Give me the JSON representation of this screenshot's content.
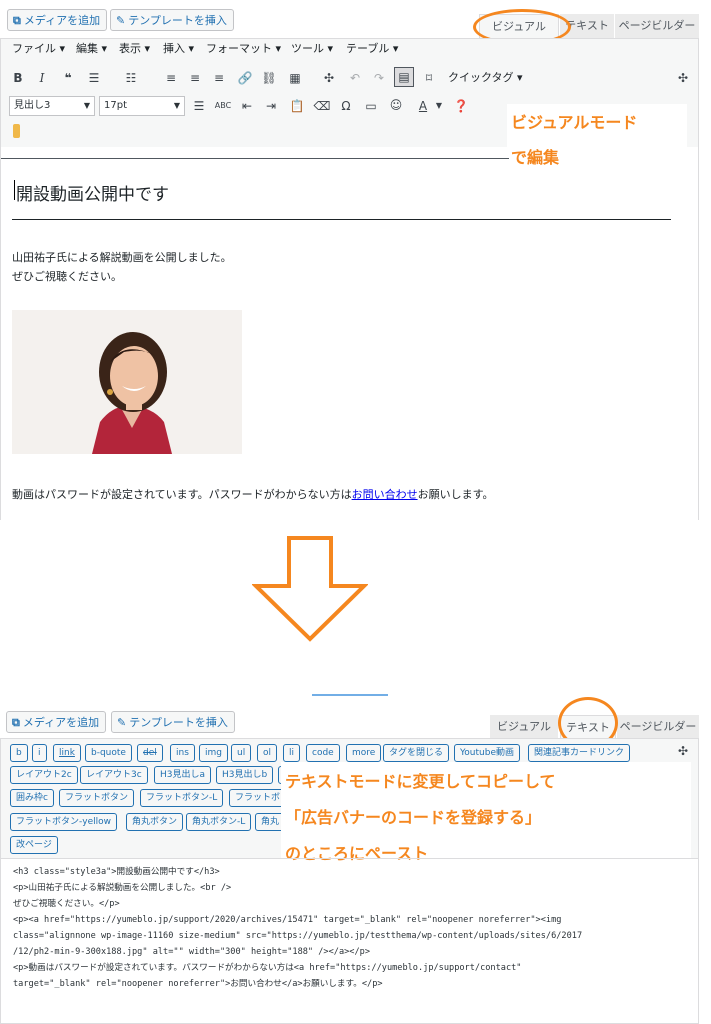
{
  "top": {
    "media_btn": "メディアを追加",
    "template_btn": "テンプレートを挿入",
    "tabs": [
      "ビジュアル",
      "テキスト",
      "ページビルダー"
    ],
    "menus": [
      "ファイル ▾",
      "編集 ▾",
      "表示 ▾",
      "挿入 ▾",
      "フォーマット ▾",
      "ツール ▾",
      "テーブル ▾"
    ],
    "quicktag": "クイックタグ ▾",
    "heading_select": "見出し3",
    "size_select": "17pt",
    "annotation": [
      "ビジュアルモード",
      "で編集"
    ],
    "content": {
      "heading": "開設動画公開中です",
      "p1": "山田祐子氏による解説動画を公開しました。",
      "p2": "ぜひご視聴ください。",
      "p3_before": "動画はパスワードが設定されています。パスワードがわからない方は",
      "p3_link": "お問い合わせ",
      "p3_after": "お願いします。"
    }
  },
  "bottom": {
    "media_btn": "メディアを追加",
    "template_btn": "テンプレートを挿入",
    "tabs": [
      "ビジュアル",
      "テキスト",
      "ページビルダー"
    ],
    "quicktags_row1": [
      "b",
      "i",
      "link",
      "b-quote",
      "del",
      "ins",
      "img",
      "ul",
      "ol",
      "li",
      "code",
      "more",
      "タグを閉じる",
      "Youtube動画",
      "関連記事カードリンク"
    ],
    "quicktags_row2": [
      "レイアウト2c",
      "レイアウト3c",
      "H3見出しa",
      "H3見出しb",
      "H3"
    ],
    "quicktags_row3": [
      "囲み枠c",
      "フラットボタン",
      "フラットボタン-L",
      "フラットボ"
    ],
    "quicktags_row4": [
      "フラットボタン-yellow",
      "角丸ボタン",
      "角丸ボタン-L",
      "角丸"
    ],
    "quicktags_row5": [
      "改ページ"
    ],
    "annotation": [
      "テキストモードに変更してコピーして",
      "「広告バナーのコードを登録する」",
      "のところにペースト"
    ],
    "code_lines": [
      "<h3 class=\"style3a\">開設動画公開中です</h3>",
      "<p>山田祐子氏による解説動画を公開しました。<br />",
      "ぜひご視聴ください。</p>",
      "<p><a href=\"https://yumeblo.jp/support/2020/archives/15471\" target=\"_blank\" rel=\"noopener noreferrer\"><img",
      "class=\"alignnone wp-image-11160 size-medium\" src=\"https://yumeblo.jp/testthema/wp-content/uploads/sites/6/2017",
      "/12/ph2-min-9-300x188.jpg\" alt=\"\" width=\"300\" height=\"188\" /></a></p>",
      "<p>動画はパスワードが設定されています。パスワードがわからない方は<a href=\"https://yumeblo.jp/support/contact\"",
      "target=\"_blank\" rel=\"noopener noreferrer\">お問い合わせ</a>お願いします。</p>"
    ]
  },
  "colors": {
    "accent_orange": "#f5871f",
    "wp_blue": "#2271b1",
    "toolbar_bg": "#f6f7f7"
  },
  "icons": [
    "media-icon",
    "pencil-icon",
    "bold-icon",
    "italic-icon",
    "quote-icon",
    "bullet-list-icon",
    "numbered-list-icon",
    "align-left-icon",
    "align-center-icon",
    "align-right-icon",
    "link-icon",
    "unlink-icon",
    "table-icon",
    "fullscreen-icon",
    "undo-icon",
    "redo-icon",
    "keyboard-icon",
    "bookmark-icon",
    "arrow-down-icon",
    "smiley-icon",
    "help-icon"
  ]
}
